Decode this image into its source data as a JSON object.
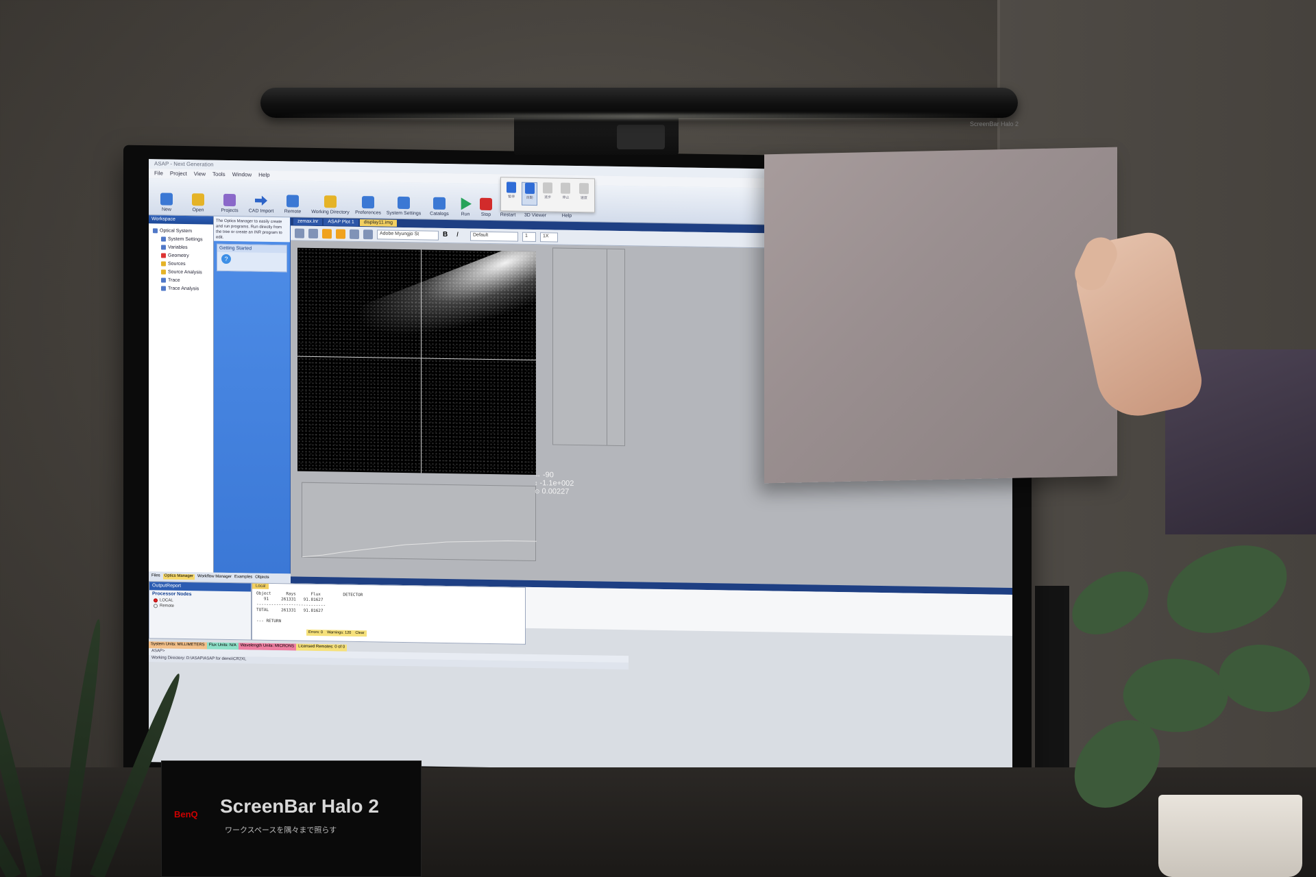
{
  "app": {
    "title": "ASAP - Next Generation",
    "menu": [
      "File",
      "Project",
      "View",
      "Tools",
      "Window",
      "Help"
    ],
    "ribbon": [
      {
        "label": "New",
        "icon": "new-file-icon"
      },
      {
        "label": "Open",
        "icon": "open-folder-icon"
      },
      {
        "label": "Projects",
        "icon": "projects-icon"
      },
      {
        "label": "CAD Import",
        "icon": "cad-import-icon"
      },
      {
        "label": "Remote",
        "icon": "remote-icon"
      },
      {
        "label": "Working Directory",
        "icon": "folder-icon"
      },
      {
        "label": "Preferences",
        "icon": "preferences-icon"
      },
      {
        "label": "System Settings",
        "icon": "system-settings-icon"
      },
      {
        "label": "Catalogs",
        "icon": "catalogs-icon"
      },
      {
        "label": "Run",
        "icon": "run-icon"
      },
      {
        "label": "Stop",
        "icon": "stop-icon"
      },
      {
        "label": "Restart",
        "icon": "restart-icon"
      },
      {
        "label": "3D Viewer",
        "icon": "3d-viewer-icon"
      },
      {
        "label": "Help",
        "icon": "help-icon"
      }
    ],
    "workspace": {
      "header": "Workspace",
      "tree": [
        {
          "label": "Optical System",
          "level": 1
        },
        {
          "label": "System Settings",
          "level": 2
        },
        {
          "label": "Variables",
          "level": 2
        },
        {
          "label": "Geometry",
          "level": 2
        },
        {
          "label": "Sources",
          "level": 2
        },
        {
          "label": "Source Analysis",
          "level": 2
        },
        {
          "label": "Trace",
          "level": 2
        },
        {
          "label": "Trace Analysis",
          "level": 2
        }
      ]
    },
    "optics_manager": {
      "description": "The Optics Manager to easily create and run programs. Run directly from the tree or create an INR program to edit.",
      "getting_started": "Getting Started",
      "help": "Help"
    },
    "left_tabs": [
      "Files",
      "Optics Manager",
      "Workflow Manager",
      "Examples",
      "Objects"
    ],
    "doc_tabs": [
      "zemax.inr",
      "ASAP Plot 1",
      "display11.img"
    ],
    "toolbar": {
      "font": "Adobe Myungjo St",
      "style": "Default",
      "size": "1",
      "zoom": "1X"
    },
    "readout": {
      "x": "-90",
      "y": "-1.1e+002",
      "value": "0.00227"
    },
    "output": {
      "header": "OutputReport",
      "processor": "Processor Nodes",
      "nodes": [
        {
          "label": "LOCAL",
          "on": true
        },
        {
          "label": "Remote",
          "on": false
        }
      ],
      "console_tab": "Local",
      "console": "Object      Rays      Flux         DETECTOR\n   91     261331   91.81627\n----------------------------\nTOTAL     261331   91.81627\n\n--- RETURN"
    },
    "status": {
      "errors": "Errors: 0",
      "warnings": "Warnings: 120",
      "clear": "Clear"
    },
    "units": {
      "system": "System Units: MILLIMETERS",
      "flux": "Flux Units: N/A",
      "wavelength": "Wavelength Units: MICRONS",
      "licensed": "Licensed Remotes: 0 of 0"
    },
    "command_prompt": "ASAP>",
    "working_dir": "Working Directory:  D:\\ASAP\\ASAP for demo\\CR2XL"
  },
  "float_toolbar": {
    "items": [
      "暫停",
      "自動",
      "逐步",
      "停止",
      "速度",
      "選取"
    ]
  },
  "lamp": {
    "brand": "ScreenBar Halo 2"
  },
  "placard": {
    "brand": "BenQ",
    "product": "ScreenBar Halo 2",
    "subtitle": "ワークスペースを隅々まで照らす"
  }
}
